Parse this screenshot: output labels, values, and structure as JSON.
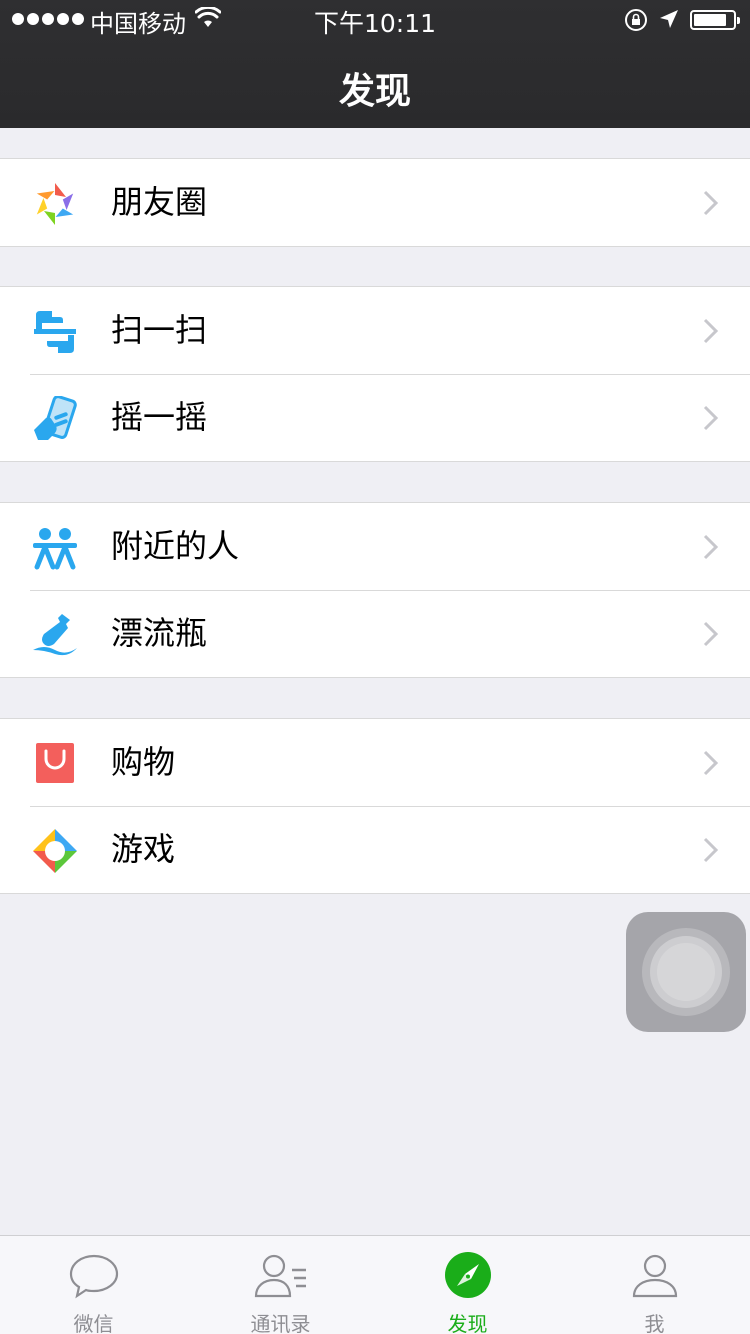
{
  "status_bar": {
    "carrier": "中国移动",
    "time": "下午10:11",
    "signal_dots": 5
  },
  "nav": {
    "title": "发现"
  },
  "groups": [
    {
      "items": [
        {
          "label": "朋友圈",
          "icon": "moments-icon"
        }
      ]
    },
    {
      "items": [
        {
          "label": "扫一扫",
          "icon": "scan-icon"
        },
        {
          "label": "摇一摇",
          "icon": "shake-icon"
        }
      ]
    },
    {
      "items": [
        {
          "label": "附近的人",
          "icon": "people-nearby-icon"
        },
        {
          "label": "漂流瓶",
          "icon": "drift-bottle-icon"
        }
      ]
    },
    {
      "items": [
        {
          "label": "购物",
          "icon": "shopping-icon"
        },
        {
          "label": "游戏",
          "icon": "games-icon"
        }
      ]
    }
  ],
  "tabbar": {
    "tabs": [
      {
        "label": "微信",
        "icon": "chat-bubble-icon",
        "active": false
      },
      {
        "label": "通讯录",
        "icon": "contacts-icon",
        "active": false
      },
      {
        "label": "发现",
        "icon": "compass-icon",
        "active": true
      },
      {
        "label": "我",
        "icon": "profile-icon",
        "active": false
      }
    ]
  },
  "colors": {
    "nav_background": "#2e2e30",
    "page_background": "#efeff4",
    "active_tab": "#1aad19",
    "inactive_tab": "#8e8e93",
    "icon_blue": "#2aa7ee",
    "shopping_red": "#f35f5c"
  }
}
